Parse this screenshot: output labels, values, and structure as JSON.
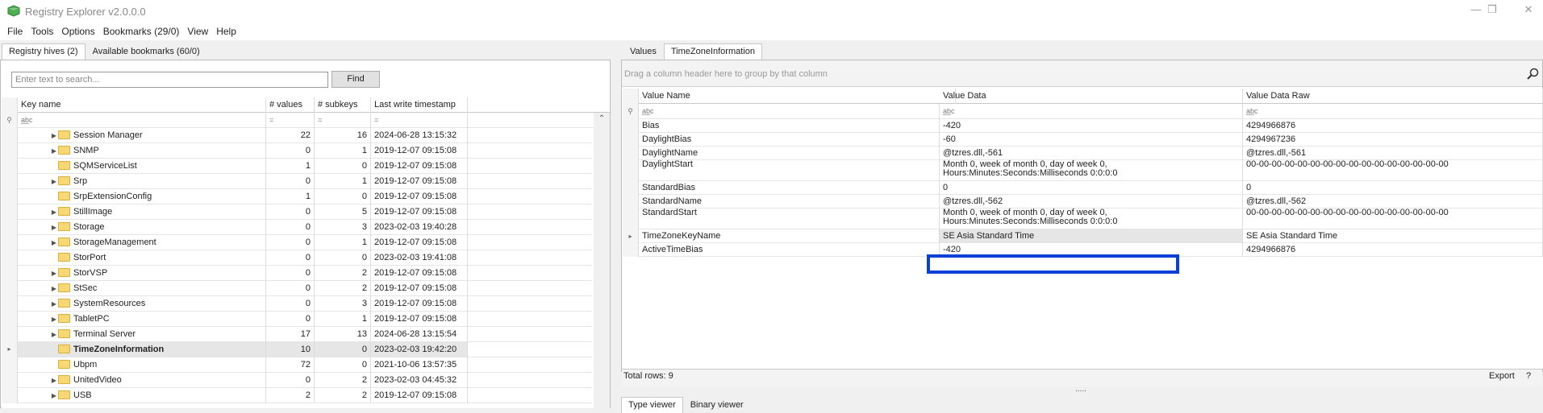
{
  "window": {
    "title": "Registry Explorer v2.0.0.0",
    "minimize": "—",
    "restore": "❐",
    "close": "✕"
  },
  "menu": [
    "File",
    "Tools",
    "Options",
    "Bookmarks (29/0)",
    "View",
    "Help"
  ],
  "left_tabs": [
    "Registry hives (2)",
    "Available bookmarks (60/0)"
  ],
  "search": {
    "placeholder": "Enter text to search...",
    "button": "Find"
  },
  "tree": {
    "columns": [
      "Key name",
      "# values",
      "# subkeys",
      "Last write timestamp"
    ],
    "filter_key": "a̲b̲c",
    "filter_eq": "=",
    "rows": [
      {
        "name": "Session Manager",
        "values": "22",
        "subkeys": "16",
        "ts": "2024-06-28 13:15:32",
        "expand": true
      },
      {
        "name": "SNMP",
        "values": "0",
        "subkeys": "1",
        "ts": "2019-12-07 09:15:08",
        "expand": true
      },
      {
        "name": "SQMServiceList",
        "values": "1",
        "subkeys": "0",
        "ts": "2019-12-07 09:15:08",
        "expand": false
      },
      {
        "name": "Srp",
        "values": "0",
        "subkeys": "1",
        "ts": "2019-12-07 09:15:08",
        "expand": true
      },
      {
        "name": "SrpExtensionConfig",
        "values": "1",
        "subkeys": "0",
        "ts": "2019-12-07 09:15:08",
        "expand": false
      },
      {
        "name": "StillImage",
        "values": "0",
        "subkeys": "5",
        "ts": "2019-12-07 09:15:08",
        "expand": true
      },
      {
        "name": "Storage",
        "values": "0",
        "subkeys": "3",
        "ts": "2023-02-03 19:40:28",
        "expand": true
      },
      {
        "name": "StorageManagement",
        "values": "0",
        "subkeys": "1",
        "ts": "2019-12-07 09:15:08",
        "expand": true
      },
      {
        "name": "StorPort",
        "values": "0",
        "subkeys": "0",
        "ts": "2023-02-03 19:41:08",
        "expand": false
      },
      {
        "name": "StorVSP",
        "values": "0",
        "subkeys": "2",
        "ts": "2019-12-07 09:15:08",
        "expand": true
      },
      {
        "name": "StSec",
        "values": "0",
        "subkeys": "2",
        "ts": "2019-12-07 09:15:08",
        "expand": true
      },
      {
        "name": "SystemResources",
        "values": "0",
        "subkeys": "3",
        "ts": "2019-12-07 09:15:08",
        "expand": true
      },
      {
        "name": "TabletPC",
        "values": "0",
        "subkeys": "1",
        "ts": "2019-12-07 09:15:08",
        "expand": true
      },
      {
        "name": "Terminal Server",
        "values": "17",
        "subkeys": "13",
        "ts": "2024-06-28 13:15:54",
        "expand": true
      },
      {
        "name": "TimeZoneInformation",
        "values": "10",
        "subkeys": "0",
        "ts": "2023-02-03 19:42:20",
        "expand": false,
        "selected": true
      },
      {
        "name": "Ubpm",
        "values": "72",
        "subkeys": "0",
        "ts": "2021-10-06 13:57:35",
        "expand": false
      },
      {
        "name": "UnitedVideo",
        "values": "0",
        "subkeys": "2",
        "ts": "2023-02-03 04:45:32",
        "expand": true
      },
      {
        "name": "USB",
        "values": "2",
        "subkeys": "2",
        "ts": "2019-12-07 09:15:08",
        "expand": true
      }
    ]
  },
  "right_tabs": [
    "Values",
    "TimeZoneInformation"
  ],
  "group_hint": "Drag a column header here to group by that column",
  "values": {
    "columns": [
      "Value Name",
      "Value Data",
      "Value Data Raw"
    ],
    "filter": "a̲b̲c",
    "rows": [
      {
        "name": "Bias",
        "data": "-420",
        "raw": "4294966876"
      },
      {
        "name": "DaylightBias",
        "data": "-60",
        "raw": "4294967236"
      },
      {
        "name": "DaylightName",
        "data": "@tzres.dll,-561",
        "raw": "@tzres.dll,-561"
      },
      {
        "name": "DaylightStart",
        "data": "Month 0, week of month 0, day of week 0,",
        "data2": "Hours:Minutes:Seconds:Milliseconds 0:0:0:0",
        "raw": "00-00-00-00-00-00-00-00-00-00-00-00-00-00-00-00"
      },
      {
        "name": "StandardBias",
        "data": "0",
        "raw": "0"
      },
      {
        "name": "StandardName",
        "data": "@tzres.dll,-562",
        "raw": "@tzres.dll,-562"
      },
      {
        "name": "StandardStart",
        "data": "Month 0, week of month 0, day of week 0,",
        "data2": "Hours:Minutes:Seconds:Milliseconds 0:0:0:0",
        "raw": "00-00-00-00-00-00-00-00-00-00-00-00-00-00-00-00"
      },
      {
        "name": "TimeZoneKeyName",
        "data": "SE Asia Standard Time",
        "raw": "SE Asia Standard Time"
      },
      {
        "name": "ActiveTimeBias",
        "data": "-420",
        "raw": "4294966876"
      }
    ]
  },
  "footer": {
    "total": "Total rows: 9",
    "export": "Export",
    "help": "?",
    "grip": "....."
  },
  "bottom_tabs": [
    "Type viewer",
    "Binary viewer"
  ],
  "colors": {
    "highlight": "#0a3fd8",
    "folder": "#f8d775"
  }
}
